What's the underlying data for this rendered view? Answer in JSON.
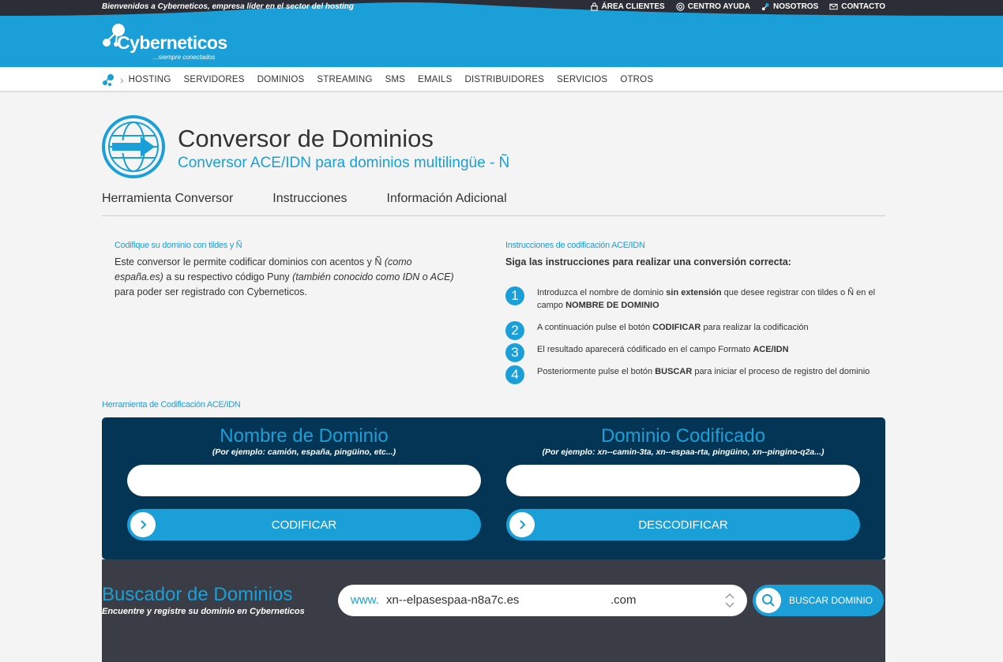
{
  "topbar": {
    "welcome": "Bienvenidos a Cyberneticos, empresa líder en el sector del hosting",
    "links": [
      {
        "label": "ÁREA CLIENTES",
        "icon": "lock-icon"
      },
      {
        "label": "CENTRO AYUDA",
        "icon": "lifebuoy-icon"
      },
      {
        "label": "NOSOTROS",
        "icon": "molecule-icon"
      },
      {
        "label": "CONTACTO",
        "icon": "envelope-icon"
      }
    ]
  },
  "header": {
    "logo_text": "Cyberneticos",
    "logo_tagline": "...siempre conectados"
  },
  "nav": {
    "items": [
      "HOSTING",
      "SERVIDORES",
      "DOMINIOS",
      "STREAMING",
      "SMS",
      "EMAILS",
      "DISTRIBUIDORES",
      "SERVICIOS",
      "OTROS"
    ]
  },
  "page": {
    "title": "Conversor de Dominios",
    "subtitle": "Conversor ACE/IDN para dominios multilingüe - Ñ"
  },
  "tabs": [
    "Herramienta Conversor",
    "Instrucciones",
    "Información Adicional"
  ],
  "intro": {
    "heading": "Codifique su dominio con tildes y Ñ",
    "text_1": "Este conversor le permite codificar dominios con acentos y Ñ ",
    "text_em1": "(como españa.es)",
    "text_2": " a su respectivo código Puny ",
    "text_em2": "(también conocido como IDN o ACE)",
    "text_3": " para poder ser registrado con Cyberneticos."
  },
  "instructions": {
    "heading": "Instrucciones de codificación ACE/IDN",
    "subheading": "Siga las instrucciones para realizar una conversión correcta:",
    "steps": [
      {
        "num": "1",
        "a": "Introduzca el nombre de dominio ",
        "b": "sin extensión",
        "c": " que desee registrar con tildes o Ñ en el campo ",
        "d": "NOMBRE DE DOMINIO",
        "e": ""
      },
      {
        "num": "2",
        "a": "A continuación pulse el botón ",
        "b": "CODIFICAR",
        "c": " para realizar la codificación",
        "d": "",
        "e": ""
      },
      {
        "num": "3",
        "a": "El resultado aparecerá códificado en el campo Formato ",
        "b": "ACE/IDN",
        "c": "",
        "d": "",
        "e": ""
      },
      {
        "num": "4",
        "a": "Posteriormente pulse el botón ",
        "b": "BUSCAR",
        "c": " para iniciar el proceso de registro del dominio",
        "d": "",
        "e": ""
      }
    ]
  },
  "tool": {
    "label": "Herramienta de Codificación ACE/IDN",
    "left": {
      "title": "Nombre de Dominio",
      "example": "(Por ejemplo: camión, españa, pingüino, etc...)",
      "value": "",
      "button": "CODIFICAR"
    },
    "right": {
      "title": "Dominio Codificado",
      "example": "(Por ejemplo: xn--camin-3ta, xn--espaa-rta, pingüino, xn--pingino-q2a...)",
      "value": "",
      "button": "DESCODIFICAR"
    }
  },
  "search": {
    "title": "Buscador de Dominios",
    "subtitle": "Encuentre y registre su dominio en Cyberneticos",
    "prefix": "www.",
    "value": "xn--elpasespaa-n8a7c.es",
    "tld": ".com",
    "button": "BUSCAR DOMINIO"
  },
  "colors": {
    "accent": "#1a9fd8",
    "dark_navy": "#053554",
    "dark_gray": "#3a3d45"
  }
}
